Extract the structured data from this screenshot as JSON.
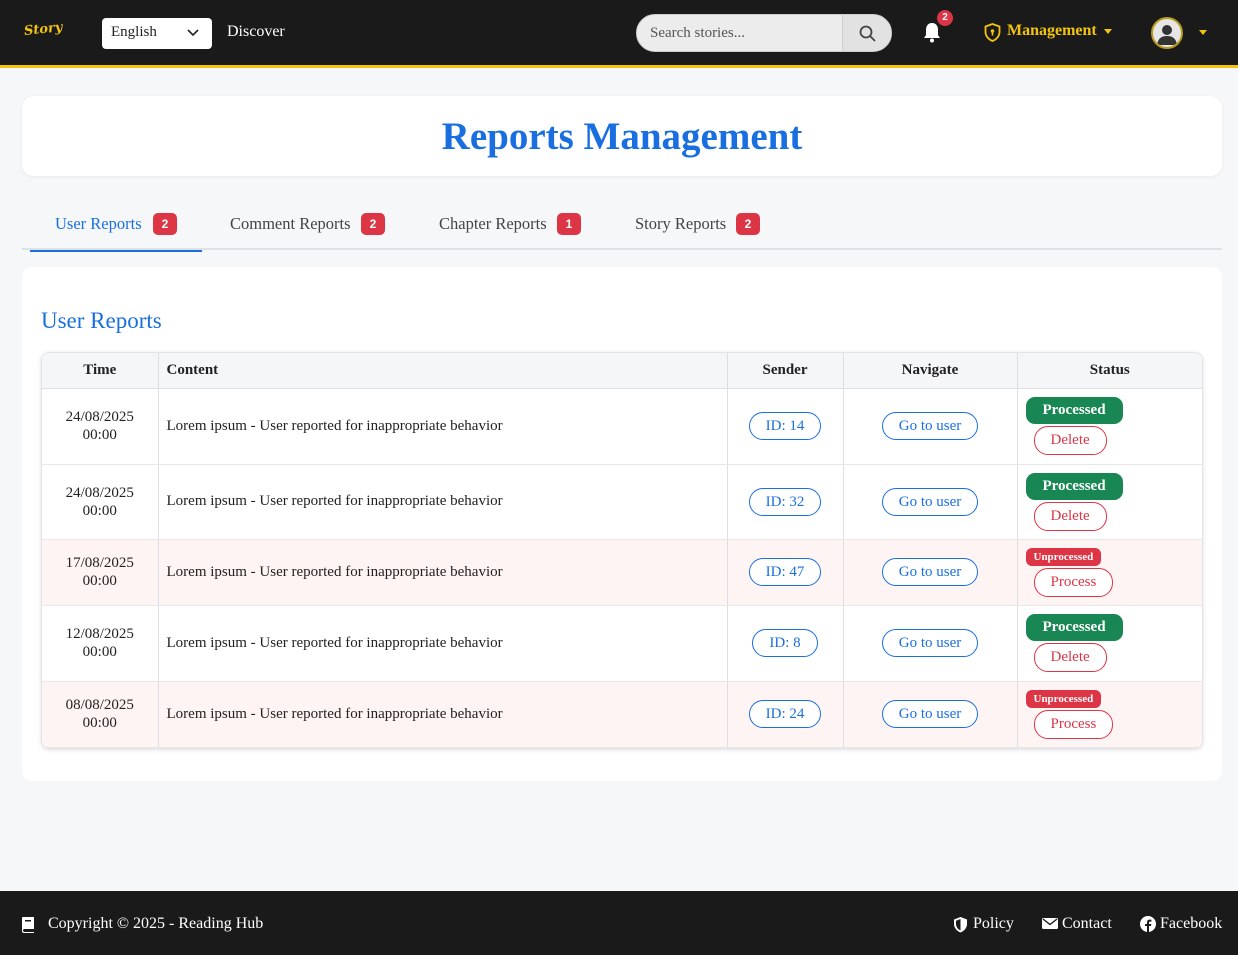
{
  "navbar": {
    "logo_text": "Story",
    "language": "English",
    "discover_label": "Discover",
    "search_placeholder": "Search stories...",
    "notification_count": "2",
    "management_label": "Management",
    "accent_color": "#f2c40f"
  },
  "page": {
    "title": "Reports Management"
  },
  "tabs": [
    {
      "label": "User Reports",
      "count": "2",
      "active": true
    },
    {
      "label": "Comment Reports",
      "count": "2",
      "active": false
    },
    {
      "label": "Chapter Reports",
      "count": "1",
      "active": false
    },
    {
      "label": "Story Reports",
      "count": "2",
      "active": false
    }
  ],
  "section": {
    "title": "User Reports"
  },
  "table": {
    "headers": {
      "time": "Time",
      "content": "Content",
      "sender": "Sender",
      "navigate": "Navigate",
      "status": "Status"
    },
    "rows": [
      {
        "date": "24/08/2025",
        "time": "00:00",
        "content": "Lorem ipsum - User reported for inappropriate behavior",
        "sender": "ID: 14",
        "navigate": "Go to user",
        "status": "Processed",
        "action": "Delete"
      },
      {
        "date": "24/08/2025",
        "time": "00:00",
        "content": "Lorem ipsum - User reported for inappropriate behavior",
        "sender": "ID: 32",
        "navigate": "Go to user",
        "status": "Processed",
        "action": "Delete"
      },
      {
        "date": "17/08/2025",
        "time": "00:00",
        "content": "Lorem ipsum - User reported for inappropriate behavior",
        "sender": "ID: 47",
        "navigate": "Go to user",
        "status": "Unprocessed",
        "action": "Process"
      },
      {
        "date": "12/08/2025",
        "time": "00:00",
        "content": "Lorem ipsum - User reported for inappropriate behavior",
        "sender": "ID: 8",
        "navigate": "Go to user",
        "status": "Processed",
        "action": "Delete"
      },
      {
        "date": "08/08/2025",
        "time": "00:00",
        "content": "Lorem ipsum - User reported for inappropriate behavior",
        "sender": "ID: 24",
        "navigate": "Go to user",
        "status": "Unprocessed",
        "action": "Process"
      }
    ]
  },
  "footer": {
    "copyright": "Copyright © 2025 - Reading Hub",
    "links": {
      "policy": "Policy",
      "contact": "Contact",
      "facebook": "Facebook"
    }
  }
}
